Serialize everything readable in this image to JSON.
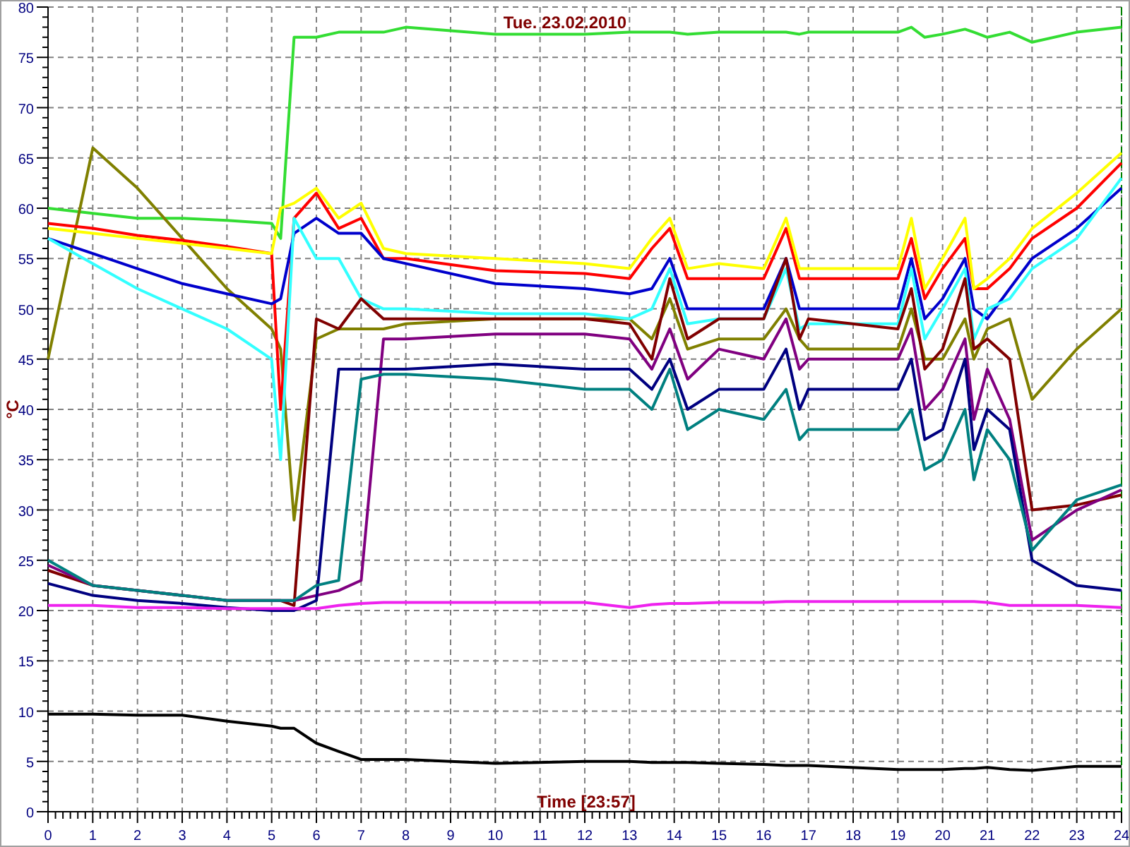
{
  "chart_data": {
    "type": "line",
    "title": "Tue. 23.02.2010",
    "xlabel": "Time [23:57]",
    "ylabel": "°C",
    "xlim": [
      0,
      24
    ],
    "ylim": [
      0,
      80
    ],
    "xticks": [
      0,
      1,
      2,
      3,
      4,
      5,
      6,
      7,
      8,
      9,
      10,
      11,
      12,
      13,
      14,
      15,
      16,
      17,
      18,
      19,
      20,
      21,
      22,
      23,
      24
    ],
    "yticks": [
      0,
      5,
      10,
      15,
      20,
      25,
      30,
      35,
      40,
      45,
      50,
      55,
      60,
      65,
      70,
      75,
      80
    ],
    "x": [
      0,
      1,
      2,
      3,
      4,
      5,
      5.2,
      5.5,
      6,
      6.5,
      7,
      7.5,
      8,
      10,
      12,
      13,
      13.5,
      13.9,
      14.3,
      15,
      16,
      16.5,
      16.8,
      17,
      19,
      19.3,
      19.6,
      20,
      20.5,
      20.7,
      21,
      21.5,
      22,
      23,
      24
    ],
    "series": [
      {
        "color": "#33dd33",
        "values": [
          60,
          59.5,
          59,
          59,
          58.8,
          58.5,
          57,
          77,
          77,
          77.5,
          77.5,
          77.5,
          78,
          77.3,
          77.3,
          77.5,
          77.5,
          77.5,
          77.3,
          77.5,
          77.5,
          77.5,
          77.3,
          77.5,
          77.5,
          78,
          77,
          77.3,
          77.8,
          77.5,
          77,
          77.5,
          76.5,
          77.5,
          78
        ]
      },
      {
        "color": "#808000",
        "values": [
          45,
          66,
          62,
          57,
          52,
          48,
          46,
          29,
          47,
          48,
          48,
          48,
          48.5,
          49,
          49,
          49,
          47,
          51,
          46,
          47,
          47,
          50,
          47,
          46,
          46,
          50,
          45,
          45,
          49,
          45,
          48,
          49,
          41,
          46,
          50
        ]
      },
      {
        "color": "#ff0000",
        "values": [
          58.5,
          58,
          57.3,
          56.8,
          56.2,
          55.5,
          40,
          59,
          61.5,
          58,
          59,
          55,
          55,
          53.8,
          53.5,
          53,
          56,
          58,
          53,
          53,
          53,
          58,
          53,
          53,
          53,
          57,
          51,
          54,
          57,
          52,
          52,
          54,
          57,
          60,
          64.5
        ]
      },
      {
        "color": "#ffff00",
        "values": [
          58,
          57.5,
          57,
          56.5,
          56,
          55.5,
          60,
          60.5,
          62,
          59,
          60.5,
          56,
          55.5,
          55,
          54.5,
          54,
          57,
          59,
          54,
          54.5,
          54,
          59,
          54,
          54,
          54,
          59,
          52,
          55,
          59,
          52,
          53,
          55,
          58,
          61.5,
          65.5
        ]
      },
      {
        "color": "#0000cc",
        "values": [
          57,
          55.5,
          54,
          52.5,
          51.5,
          50.5,
          51,
          57.5,
          59,
          57.5,
          57.5,
          55,
          54.5,
          52.5,
          52,
          51.5,
          52,
          55,
          50,
          50,
          50,
          55,
          50,
          50,
          50,
          55,
          49,
          51,
          55,
          50,
          49,
          52,
          55,
          58,
          62
        ]
      },
      {
        "color": "#33ffff",
        "values": [
          57,
          54.5,
          52,
          50,
          48,
          45,
          35,
          59,
          55,
          55,
          51,
          50,
          50,
          49.5,
          49.5,
          49,
          50,
          54,
          48.5,
          49,
          49,
          54,
          48,
          48.5,
          48.5,
          54,
          47,
          50,
          54,
          47,
          50,
          51,
          54,
          57,
          63
        ]
      },
      {
        "color": "#800000",
        "values": [
          24,
          22.5,
          22,
          21.5,
          21,
          21,
          21,
          20.5,
          49,
          48,
          51,
          49,
          49,
          49,
          49,
          48.5,
          45,
          53,
          47,
          49,
          49,
          55,
          47,
          49,
          48,
          52,
          44,
          46,
          53,
          46,
          47,
          45,
          30,
          30.5,
          31.5
        ]
      },
      {
        "color": "#800080",
        "values": [
          24.5,
          22.5,
          22,
          21.5,
          21,
          21,
          21,
          21,
          21.5,
          22,
          23,
          47,
          47,
          47.5,
          47.5,
          47,
          44,
          48,
          43,
          46,
          45,
          49,
          44,
          45,
          45,
          48,
          40,
          42,
          47,
          39,
          44,
          39,
          27,
          30,
          32
        ]
      },
      {
        "color": "#000080",
        "values": [
          22.7,
          21.5,
          21,
          20.7,
          20.3,
          20,
          20,
          20,
          21,
          44,
          44,
          44,
          44,
          44.5,
          44,
          44,
          42,
          45,
          40,
          42,
          42,
          46,
          40,
          42,
          42,
          45,
          37,
          38,
          45,
          36,
          40,
          38,
          25,
          22.5,
          22
        ]
      },
      {
        "color": "#008080",
        "values": [
          25,
          22.5,
          22,
          21.5,
          21,
          21,
          21,
          21,
          22.5,
          23,
          43,
          43.5,
          43.5,
          43,
          42,
          42,
          40,
          44,
          38,
          40,
          39,
          42,
          37,
          38,
          38,
          40,
          34,
          35,
          40,
          33,
          38,
          35,
          26,
          31,
          32.5
        ]
      },
      {
        "color": "#ee22ee",
        "values": [
          20.5,
          20.5,
          20.3,
          20.3,
          20.2,
          20.2,
          20.2,
          20.2,
          20.2,
          20.5,
          20.7,
          20.8,
          20.8,
          20.8,
          20.8,
          20.3,
          20.6,
          20.7,
          20.7,
          20.8,
          20.8,
          20.9,
          20.9,
          20.9,
          20.9,
          20.9,
          20.9,
          20.9,
          20.9,
          20.9,
          20.8,
          20.5,
          20.5,
          20.5,
          20.3
        ]
      },
      {
        "color": "#000000",
        "values": [
          9.7,
          9.7,
          9.6,
          9.6,
          9,
          8.5,
          8.3,
          8.3,
          6.8,
          6,
          5.2,
          5.2,
          5.2,
          4.8,
          5,
          5,
          4.9,
          4.9,
          4.9,
          4.8,
          4.7,
          4.6,
          4.6,
          4.6,
          4.2,
          4.2,
          4.2,
          4.2,
          4.3,
          4.3,
          4.4,
          4.2,
          4.1,
          4.5,
          4.5
        ]
      }
    ],
    "grid": true,
    "ref_lines": [
      {
        "axis": "x",
        "value": 24,
        "color": "#008000"
      }
    ]
  }
}
